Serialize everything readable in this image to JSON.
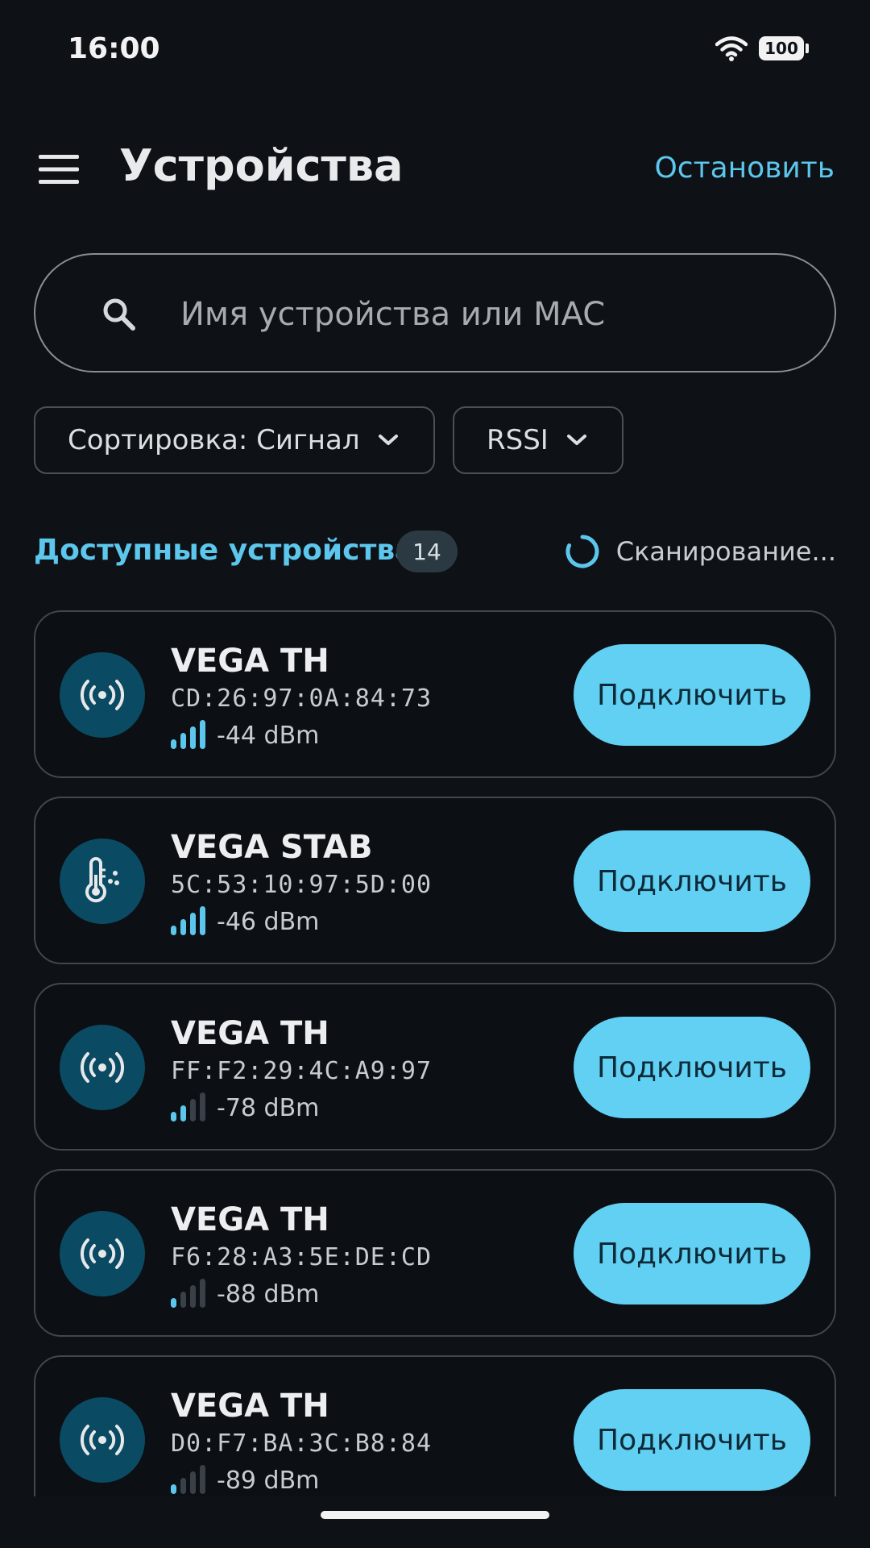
{
  "status_bar": {
    "time": "16:00",
    "battery": "100"
  },
  "header": {
    "title": "Устройства",
    "stop_label": "Остановить"
  },
  "search": {
    "placeholder": "Имя устройства или MAC",
    "value": ""
  },
  "filters": {
    "sort_label": "Сортировка: Сигнал",
    "metric_label": "RSSI"
  },
  "section": {
    "title": "Доступные устройства",
    "count": "14",
    "scan_status": "Сканирование..."
  },
  "colors": {
    "accent": "#5cc6ec",
    "button": "#62d0f3",
    "background": "#0e1116",
    "avatar": "#0b4a63"
  },
  "devices": [
    {
      "name": "VEGA TH",
      "mac": "CD:26:97:0A:84:73",
      "rssi": "-44 dBm",
      "signal_bars": 4,
      "icon": "broadcast-icon",
      "action": "Подключить"
    },
    {
      "name": "VEGA STAB",
      "mac": "5C:53:10:97:5D:00",
      "rssi": "-46 dBm",
      "signal_bars": 4,
      "icon": "thermometer-icon",
      "action": "Подключить"
    },
    {
      "name": "VEGA TH",
      "mac": "FF:F2:29:4C:A9:97",
      "rssi": "-78 dBm",
      "signal_bars": 2,
      "icon": "broadcast-icon",
      "action": "Подключить"
    },
    {
      "name": "VEGA TH",
      "mac": "F6:28:A3:5E:DE:CD",
      "rssi": "-88 dBm",
      "signal_bars": 1,
      "icon": "broadcast-icon",
      "action": "Подключить"
    },
    {
      "name": "VEGA TH",
      "mac": "D0:F7:BA:3C:B8:84",
      "rssi": "-89 dBm",
      "signal_bars": 1,
      "icon": "broadcast-icon",
      "action": "Подключить"
    }
  ]
}
